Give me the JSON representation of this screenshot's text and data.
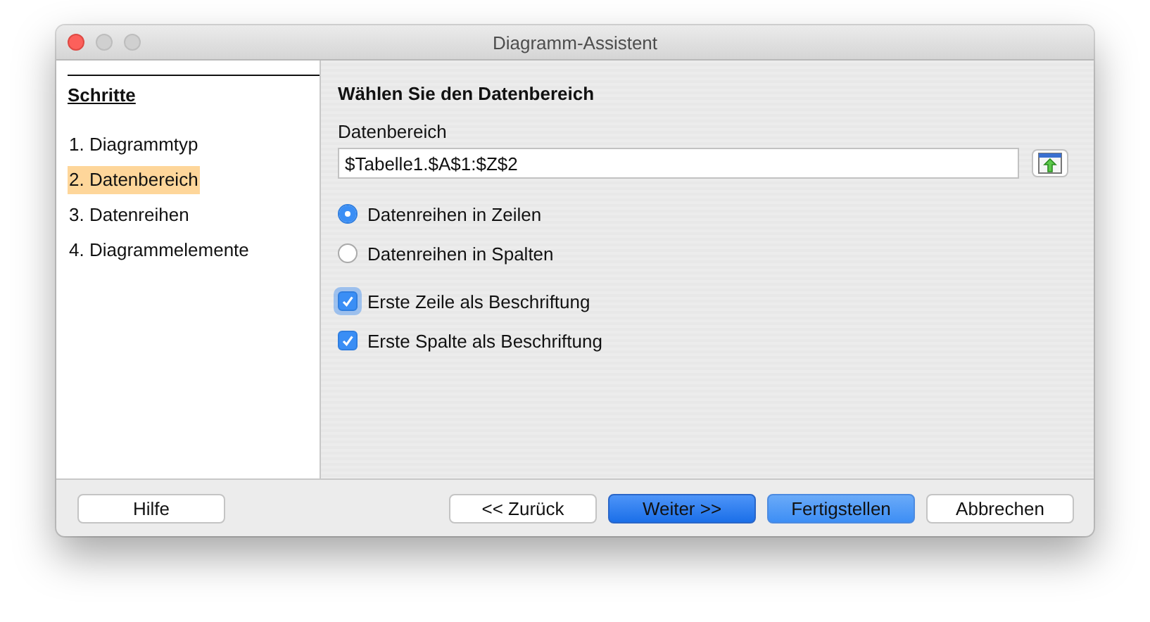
{
  "window": {
    "title": "Diagramm-Assistent"
  },
  "sidebar": {
    "heading": "Schritte",
    "steps": [
      {
        "number": "1.",
        "label": "Diagrammtyp",
        "selected": false
      },
      {
        "number": "2.",
        "label": "Datenbereich",
        "selected": true
      },
      {
        "number": "3.",
        "label": "Datenreihen",
        "selected": false
      },
      {
        "number": "4.",
        "label": "Diagrammelemente",
        "selected": false
      }
    ]
  },
  "content": {
    "heading": "Wählen Sie den Datenbereich",
    "range_label": "Datenbereich",
    "range_value": "$Tabelle1.$A$1:$Z$2",
    "radios": [
      {
        "label": "Datenreihen in Zeilen",
        "selected": true
      },
      {
        "label": "Datenreihen in Spalten",
        "selected": false
      }
    ],
    "checkboxes": [
      {
        "label": "Erste Zeile als Beschriftung",
        "checked": true,
        "focused": true
      },
      {
        "label": "Erste Spalte als Beschriftung",
        "checked": true,
        "focused": false
      }
    ]
  },
  "buttons": [
    {
      "label": "Hilfe",
      "kind": "plain"
    },
    {
      "label": "<< Zurück",
      "kind": "plain"
    },
    {
      "label": "Weiter >>",
      "kind": "default"
    },
    {
      "label": "Fertigstellen",
      "kind": "accent"
    },
    {
      "label": "Abbrechen",
      "kind": "plain"
    }
  ]
}
